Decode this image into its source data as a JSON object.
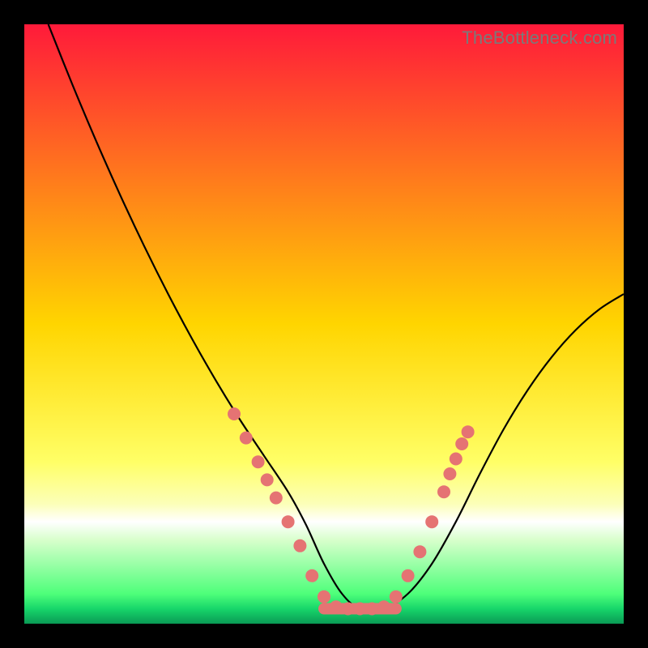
{
  "watermark": "TheBottleneck.com",
  "chart_data": {
    "type": "line",
    "title": "",
    "xlabel": "",
    "ylabel": "",
    "xlim": [
      0,
      100
    ],
    "ylim": [
      0,
      100
    ],
    "grid": false,
    "legend": false,
    "gradient_stops": [
      {
        "offset": 0.0,
        "color": "#ff1a3a"
      },
      {
        "offset": 0.5,
        "color": "#ffd500"
      },
      {
        "offset": 0.73,
        "color": "#ffff66"
      },
      {
        "offset": 0.8,
        "color": "#fcffb8"
      },
      {
        "offset": 0.83,
        "color": "#ffffff"
      },
      {
        "offset": 0.86,
        "color": "#d8ffcc"
      },
      {
        "offset": 0.95,
        "color": "#4eff7a"
      },
      {
        "offset": 0.975,
        "color": "#17d66a"
      },
      {
        "offset": 1.0,
        "color": "#0a9a55"
      }
    ],
    "series": [
      {
        "name": "bottleneck-curve",
        "x": [
          4,
          8,
          12,
          16,
          20,
          24,
          28,
          32,
          36,
          40,
          44,
          47,
          50,
          53,
          56,
          60,
          64,
          68,
          72,
          76,
          80,
          84,
          88,
          92,
          96,
          100
        ],
        "values": [
          100,
          90,
          80.5,
          71.5,
          63,
          55,
          47.5,
          40.5,
          34,
          28,
          22,
          16.5,
          10,
          5,
          2.5,
          2.5,
          5,
          10,
          17,
          25,
          32.5,
          39,
          44.5,
          49,
          52.5,
          55
        ]
      }
    ],
    "scatter": {
      "name": "data-points",
      "color": "#e57373",
      "radius": 8,
      "points": [
        {
          "x": 35,
          "y": 35
        },
        {
          "x": 37,
          "y": 31
        },
        {
          "x": 39,
          "y": 27
        },
        {
          "x": 40.5,
          "y": 24
        },
        {
          "x": 42,
          "y": 21
        },
        {
          "x": 44,
          "y": 17
        },
        {
          "x": 46,
          "y": 13
        },
        {
          "x": 48,
          "y": 8
        },
        {
          "x": 50,
          "y": 4.5
        },
        {
          "x": 52,
          "y": 2.8
        },
        {
          "x": 54,
          "y": 2.5
        },
        {
          "x": 56,
          "y": 2.5
        },
        {
          "x": 58,
          "y": 2.5
        },
        {
          "x": 60,
          "y": 2.8
        },
        {
          "x": 62,
          "y": 4.5
        },
        {
          "x": 64,
          "y": 8
        },
        {
          "x": 66,
          "y": 12
        },
        {
          "x": 68,
          "y": 17
        },
        {
          "x": 70,
          "y": 22
        },
        {
          "x": 71,
          "y": 25
        },
        {
          "x": 72,
          "y": 27.5
        },
        {
          "x": 73,
          "y": 30
        },
        {
          "x": 74,
          "y": 32
        }
      ]
    },
    "flat_segment": {
      "x1": 50,
      "x2": 62,
      "y": 2.5,
      "stroke_width": 14,
      "color": "#e57373"
    }
  }
}
